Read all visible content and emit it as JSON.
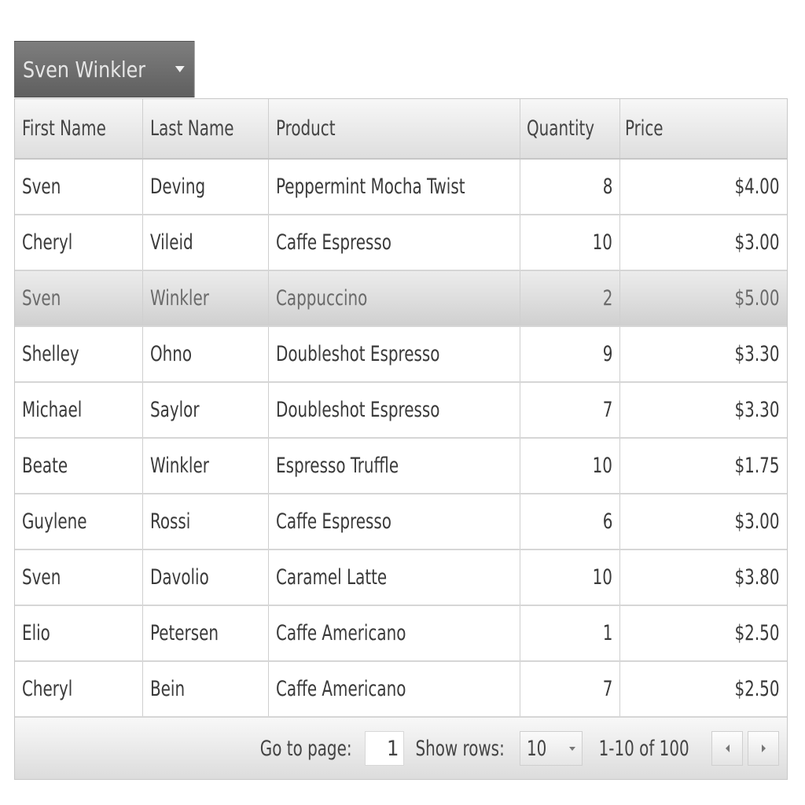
{
  "dropdown": {
    "label": "Sven Winkler"
  },
  "grid": {
    "columns": [
      "First Name",
      "Last Name",
      "Product",
      "Quantity",
      "Price"
    ],
    "rows": [
      [
        "Sven",
        "Deving",
        "Peppermint Mocha Twist",
        "8",
        "$4.00"
      ],
      [
        "Cheryl",
        "Vileid",
        "Caffe Espresso",
        "10",
        "$3.00"
      ],
      [
        "Sven",
        "Winkler",
        "Cappuccino",
        "2",
        "$5.00"
      ],
      [
        "Shelley",
        "Ohno",
        "Doubleshot Espresso",
        "9",
        "$3.30"
      ],
      [
        "Michael",
        "Saylor",
        "Doubleshot Espresso",
        "7",
        "$3.30"
      ],
      [
        "Beate",
        "Winkler",
        "Espresso Truffle",
        "10",
        "$1.75"
      ],
      [
        "Guylene",
        "Rossi",
        "Caffe Espresso",
        "6",
        "$3.00"
      ],
      [
        "Sven",
        "Davolio",
        "Caramel Latte",
        "10",
        "$3.80"
      ],
      [
        "Elio",
        "Petersen",
        "Caffe Americano",
        "1",
        "$2.50"
      ],
      [
        "Cheryl",
        "Bein",
        "Caffe Americano",
        "7",
        "$2.50"
      ]
    ],
    "selected_row_index": 2
  },
  "pager": {
    "go_to_page_label": "Go to page:",
    "page_value": "1",
    "show_rows_label": "Show rows:",
    "rows_value": "10",
    "range_text": "1-10 of 100"
  },
  "icons": {
    "dropdown": "chevron-down-icon",
    "rows_select": "chevron-down-icon",
    "prev": "arrow-left-icon",
    "next": "arrow-right-icon"
  },
  "colors": {
    "dropdown_bg": "#6e6e6e",
    "selected_row_bg": "#dcdcdc",
    "header_bg": "#e8e8e8"
  }
}
